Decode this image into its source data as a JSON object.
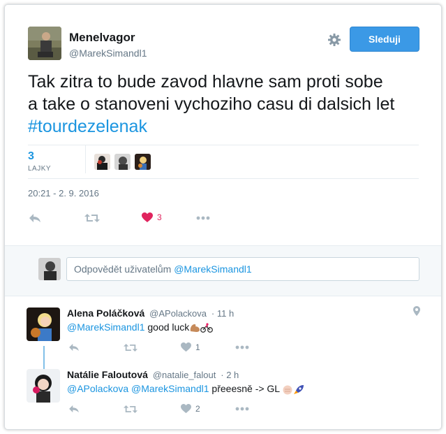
{
  "author": {
    "name": "Menelvagor",
    "handle": "@MarekSimandl1",
    "follow_label": "Sleduji"
  },
  "tweet": {
    "text_line1": "Tak zitra to bude zavod hlavne sam proti sobe",
    "text_line2": "a take o stanoveni vychoziho casu di dalsich let",
    "hashtag": "#tourdezelenak",
    "likes_count": "3",
    "likes_label": "LAJKY",
    "timestamp": "20:21 - 2. 9. 2016",
    "like_action_count": "3"
  },
  "reply_box": {
    "placeholder_prefix": "Odpovědět uživatelům",
    "placeholder_mention": "@MarekSimandl1"
  },
  "replies": [
    {
      "name": "Alena Poláčková",
      "handle": "@APolackova",
      "time": "11 h",
      "mention1": "@MarekSimandl1",
      "mention2": "",
      "text": "good luck",
      "like_count": "1"
    },
    {
      "name": "Natálie Faloutová",
      "handle": "@natalie_falout",
      "time": "2 h",
      "mention1": "@APolackova",
      "mention2": "@MarekSimandl1",
      "text": "přeeesně -> GL",
      "like_count": "2"
    }
  ],
  "colors": {
    "accent": "#1b95e0",
    "follow_bg": "#3b99e6",
    "like_red": "#e0245e",
    "muted": "#657786"
  }
}
